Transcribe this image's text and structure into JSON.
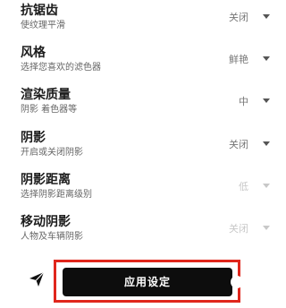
{
  "settings": [
    {
      "title": "抗锯齿",
      "desc": "使纹理平滑",
      "value": "关闭",
      "disabled": false
    },
    {
      "title": "风格",
      "desc": "选择您喜欢的滤色器",
      "value": "鲜艳",
      "disabled": false
    },
    {
      "title": "渲染质量",
      "desc": "阴影 着色器等",
      "value": "中",
      "disabled": false
    },
    {
      "title": "阴影",
      "desc": "开启或关闭阴影",
      "value": "关闭",
      "disabled": false
    },
    {
      "title": "阴影距离",
      "desc": "选择阴影距离级别",
      "value": "低",
      "disabled": true
    },
    {
      "title": "移动阴影",
      "desc": "人物及车辆阴影",
      "value": "关闭",
      "disabled": true
    }
  ],
  "bottom": {
    "apply_label": "应用设定",
    "send_icon": "send-icon",
    "highlight_color": "#e0261c",
    "button_color": "#0d0d0d"
  }
}
